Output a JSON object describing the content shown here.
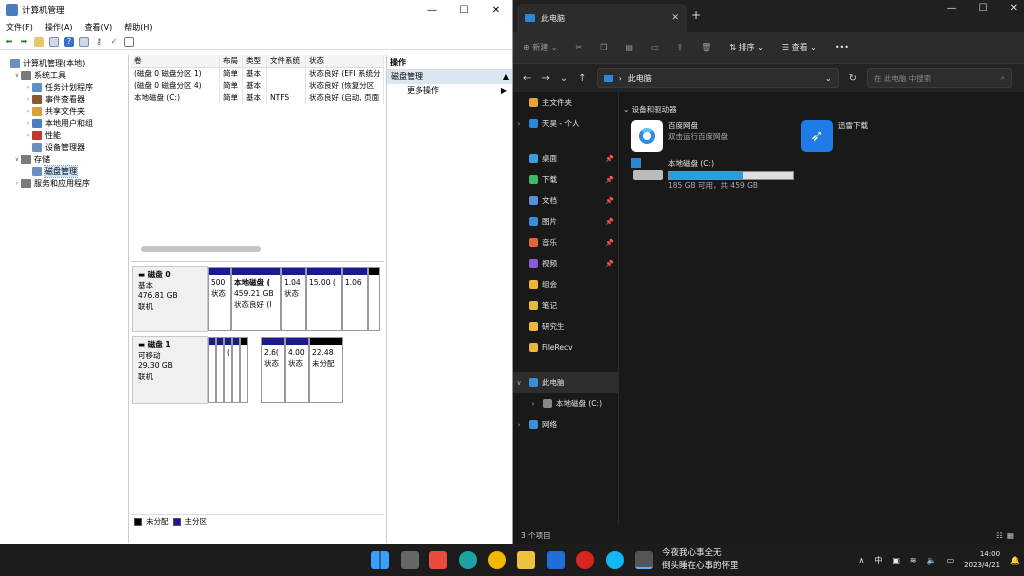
{
  "left_window": {
    "title": "计算机管理",
    "menu": [
      "文件(F)",
      "操作(A)",
      "查看(V)",
      "帮助(H)"
    ],
    "tree": [
      {
        "label": "计算机管理(本地)",
        "indent": 0,
        "exp": ""
      },
      {
        "label": "系统工具",
        "indent": 1,
        "exp": "∨"
      },
      {
        "label": "任务计划程序",
        "indent": 2,
        "exp": "›"
      },
      {
        "label": "事件查看器",
        "indent": 2,
        "exp": "›"
      },
      {
        "label": "共享文件夹",
        "indent": 2,
        "exp": "›"
      },
      {
        "label": "本地用户和组",
        "indent": 2,
        "exp": "›"
      },
      {
        "label": "性能",
        "indent": 2,
        "exp": "›"
      },
      {
        "label": "设备管理器",
        "indent": 2,
        "exp": ""
      },
      {
        "label": "存储",
        "indent": 1,
        "exp": "∨"
      },
      {
        "label": "磁盘管理",
        "indent": 2,
        "exp": ""
      },
      {
        "label": "服务和应用程序",
        "indent": 1,
        "exp": "›"
      }
    ],
    "volume_headers": [
      "卷",
      "布局",
      "类型",
      "文件系统",
      "状态"
    ],
    "volumes": [
      [
        "(磁盘 0 磁盘分区 1)",
        "简单",
        "基本",
        "",
        "状态良好 (EFI 系统分"
      ],
      [
        "(磁盘 0 磁盘分区 4)",
        "简单",
        "基本",
        "",
        "状态良好 (恢复分区"
      ],
      [
        "本地磁盘 (C:)",
        "简单",
        "基本",
        "NTFS",
        "状态良好 (启动, 页面"
      ]
    ],
    "disk0": {
      "name": "磁盘 0",
      "type": "基本",
      "size": "476.81 GB",
      "state": "联机",
      "parts": [
        {
          "l1": "500",
          "l2": "状态"
        },
        {
          "l1": "本地磁盘  (",
          "l2": "459.21 GB",
          "l3": "状态良好 (I"
        },
        {
          "l1": "1.04",
          "l2": "状态"
        },
        {
          "l1": "15.00 (",
          "l2": ""
        },
        {
          "l1": "1.06",
          "l2": ""
        },
        {
          "l1": "",
          "l2": ""
        }
      ]
    },
    "disk1": {
      "name": "磁盘 1",
      "type": "可移动",
      "size": "29.30 GB",
      "state": "联机",
      "parts": [
        {
          "l1": "",
          "l2": ""
        },
        {
          "l1": "",
          "l2": ""
        },
        {
          "l1": "(",
          "l2": ""
        },
        {
          "l1": "",
          "l2": ""
        },
        {
          "l1": "",
          "l2": ""
        },
        {
          "l1": "2.6(",
          "l2": "状态"
        },
        {
          "l1": "4.00",
          "l2": "状态"
        },
        {
          "l1": "22.48",
          "l2": "未分配"
        }
      ]
    },
    "legend": [
      "未分配",
      "主分区"
    ],
    "actions_title": "操作",
    "actions_item": "磁盘管理",
    "actions_more": "更多操作"
  },
  "explorer": {
    "tab_title": "此电脑",
    "cmd": {
      "new": "新建",
      "sort": "排序",
      "view": "查看"
    },
    "path": "此电脑",
    "search_placeholder": "在 此电脑 中搜索",
    "nav": [
      {
        "label": "主文件夹",
        "color": "#e8a33c",
        "exp": "",
        "pin": false
      },
      {
        "label": "天昊 - 个人",
        "color": "#2b88d8",
        "exp": "›",
        "pin": false
      },
      {
        "label": "",
        "color": "",
        "exp": "",
        "pin": false
      },
      {
        "label": "桌面",
        "color": "#3aa0e0",
        "exp": "",
        "pin": true
      },
      {
        "label": "下载",
        "color": "#3cba6a",
        "exp": "",
        "pin": true
      },
      {
        "label": "文档",
        "color": "#5a8fd8",
        "exp": "",
        "pin": true
      },
      {
        "label": "图片",
        "color": "#3a8fd8",
        "exp": "",
        "pin": true
      },
      {
        "label": "音乐",
        "color": "#e8623c",
        "exp": "",
        "pin": true
      },
      {
        "label": "视频",
        "color": "#8a5ad8",
        "exp": "",
        "pin": true
      },
      {
        "label": "组会",
        "color": "#e8b73c",
        "exp": "",
        "pin": false
      },
      {
        "label": "笔记",
        "color": "#e8b73c",
        "exp": "",
        "pin": false
      },
      {
        "label": "研究生",
        "color": "#e8b73c",
        "exp": "",
        "pin": false
      },
      {
        "label": "FileRecv",
        "color": "#e8b73c",
        "exp": "",
        "pin": false
      },
      {
        "label": "",
        "color": "",
        "exp": "",
        "pin": false
      },
      {
        "label": "此电脑",
        "color": "#3a8fd8",
        "exp": "∨",
        "pin": false
      },
      {
        "label": "本地磁盘 (C:)",
        "color": "#888888",
        "exp": "›",
        "pin": false
      },
      {
        "label": "网络",
        "color": "#3a8fd8",
        "exp": "›",
        "pin": false
      }
    ],
    "section": "设备和驱动器",
    "baidu": {
      "name": "百度网盘",
      "sub": "双击运行百度网盘"
    },
    "xunlei": {
      "name": "迅雷下载"
    },
    "cdrive": {
      "name": "本地磁盘 (C:)",
      "free": "185 GB 可用，共 459 GB",
      "used_fraction": 0.597
    },
    "status": "3 个项目"
  },
  "taskbar": {
    "song_line1": "今夜我心事全无",
    "song_line2": "倒头睡在心事的怀里",
    "ime": "中",
    "time": "14:00",
    "date": "2023/4/21"
  }
}
